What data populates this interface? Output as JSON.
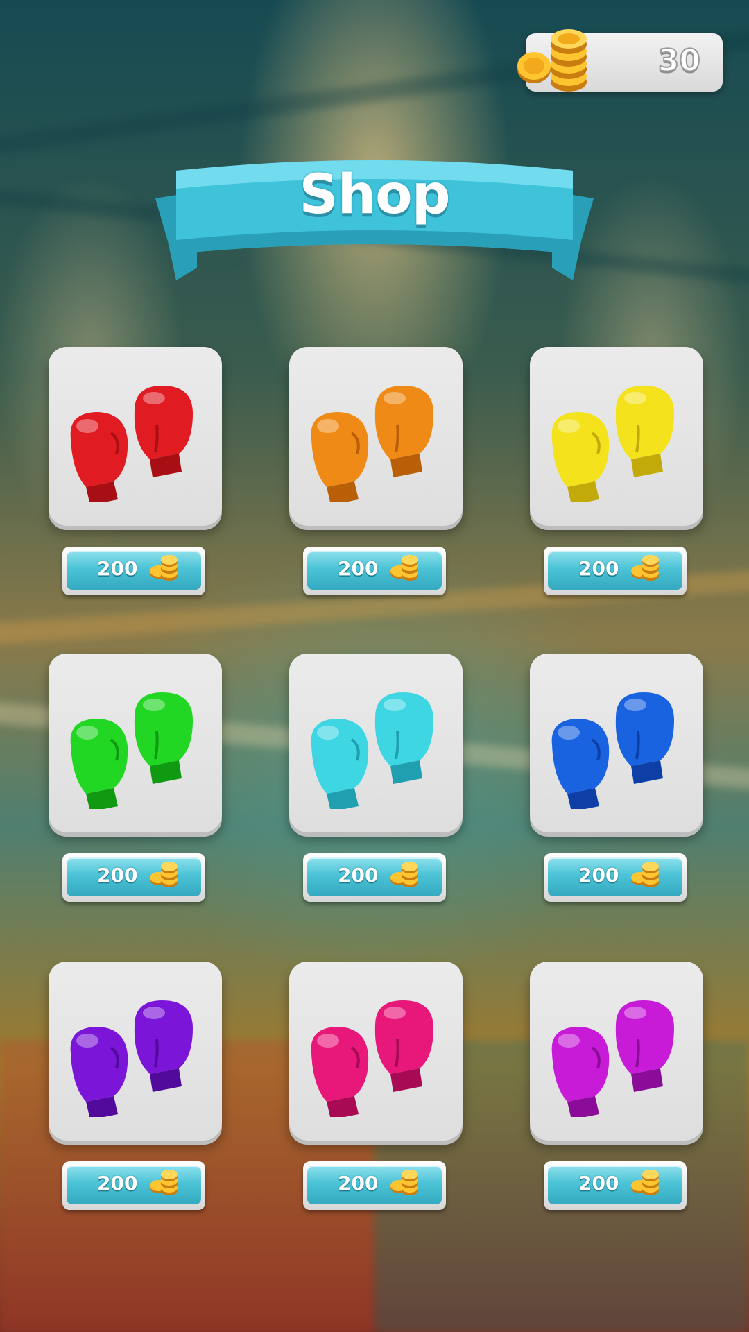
{
  "hud": {
    "coin_balance": "30",
    "coin_icon": "coin-stack-icon"
  },
  "header": {
    "title": "Shop",
    "banner_color": "#3ec3db"
  },
  "shop_items": [
    {
      "glove_color": "#e01b22",
      "glove_shade": "#a80f14",
      "price": "200",
      "price_icon": "coin-icon"
    },
    {
      "glove_color": "#f08a16",
      "glove_shade": "#b85f07",
      "price": "200",
      "price_icon": "coin-icon"
    },
    {
      "glove_color": "#f3e21c",
      "glove_shade": "#c2aa0a",
      "price": "200",
      "price_icon": "coin-icon"
    },
    {
      "glove_color": "#22d624",
      "glove_shade": "#0f9a12",
      "price": "200",
      "price_icon": "coin-icon"
    },
    {
      "glove_color": "#3fd6e3",
      "glove_shade": "#1f9fb0",
      "price": "200",
      "price_icon": "coin-icon"
    },
    {
      "glove_color": "#1a63e0",
      "glove_shade": "#0d3fa6",
      "price": "200",
      "price_icon": "coin-icon"
    },
    {
      "glove_color": "#7b16d9",
      "glove_shade": "#520a9c",
      "price": "200",
      "price_icon": "coin-icon"
    },
    {
      "glove_color": "#e8177a",
      "glove_shade": "#a80a53",
      "price": "200",
      "price_icon": "coin-icon"
    },
    {
      "glove_color": "#c81bd8",
      "glove_shade": "#8c0c9a",
      "price": "200",
      "price_icon": "coin-icon"
    }
  ]
}
